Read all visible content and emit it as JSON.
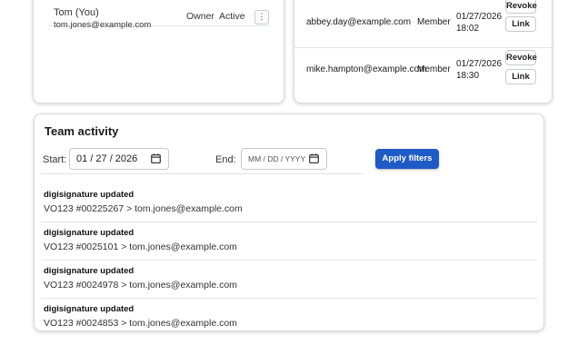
{
  "members": [
    {
      "name": "Tom (You)",
      "email": "tom.jones@example.com",
      "role": "Owner",
      "status": "Active",
      "menu_label": "⋮"
    }
  ],
  "invites": [
    {
      "email": "abbey.day@example.com",
      "role": "Member",
      "date": "01/27/2026",
      "time": "18:02",
      "revoke_label": "Revoke",
      "link_label": "Link"
    },
    {
      "email": "mike.hampton@example.com",
      "role": "Member",
      "date": "01/27/2026",
      "time": "18:30",
      "revoke_label": "Revoke",
      "link_label": "Link"
    }
  ],
  "activity": {
    "title": "Team activity",
    "start_label": "Start:",
    "start_value": "01 / 27 / 2026",
    "end_label": "End:",
    "end_placeholder": "MM / DD / YYYY",
    "apply_label": "Apply filters",
    "accent_color": "#1f5bc6",
    "items": [
      {
        "action": "digisignature updated",
        "detail": "VO123  #00225267  >  tom.jones@example.com"
      },
      {
        "action": "digisignature updated",
        "detail": "VO123  #0025101  >  tom.jones@example.com"
      },
      {
        "action": "digisignature updated",
        "detail": "VO123  #0024978  >  tom.jones@example.com"
      },
      {
        "action": "digisignature updated",
        "detail": "VO123  #0024853  >  tom.jones@example.com"
      }
    ]
  }
}
